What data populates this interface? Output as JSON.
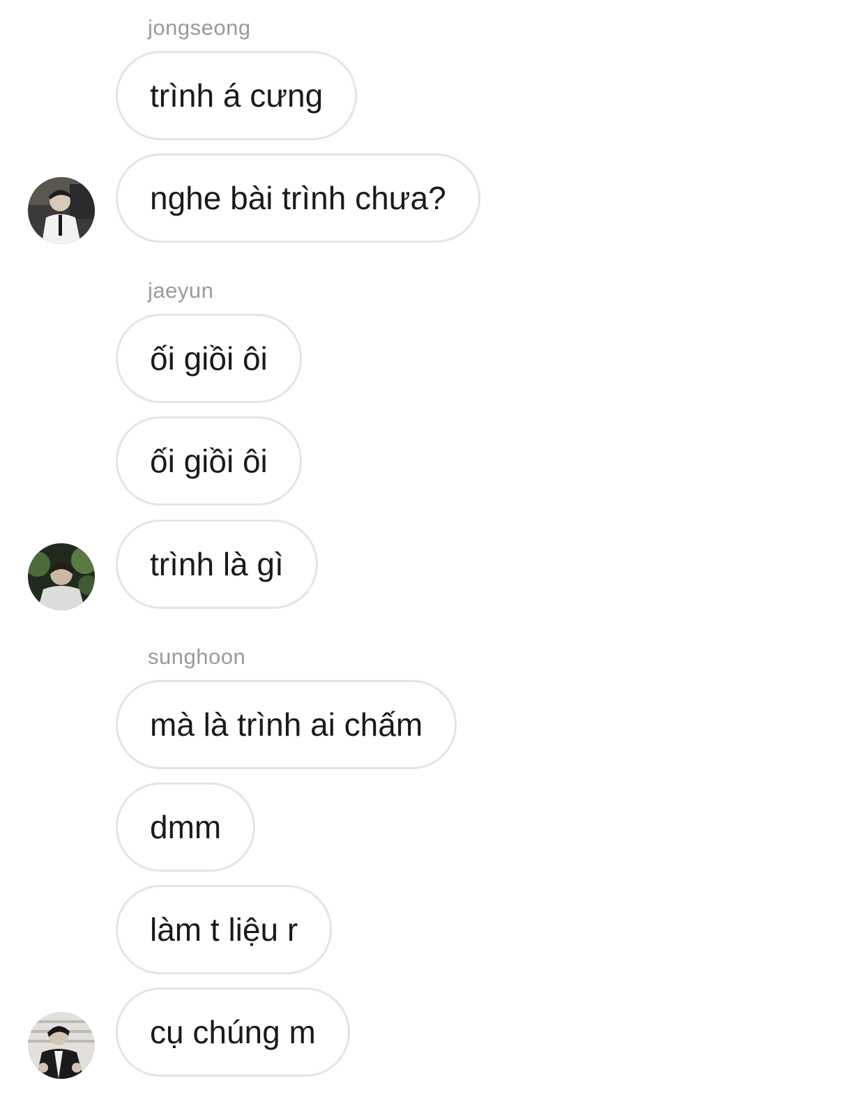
{
  "groups": [
    {
      "sender": "jongseong",
      "avatar": "profile-photo-jongseong",
      "messages": [
        "trình á cưng",
        "nghe bài trình chưa?"
      ]
    },
    {
      "sender": "jaeyun",
      "avatar": "profile-photo-jaeyun",
      "messages": [
        "ối giồi ôi",
        "ối giồi ôi",
        "trình là gì"
      ]
    },
    {
      "sender": "sunghoon",
      "avatar": "profile-photo-sunghoon",
      "messages": [
        "mà là trình ai chấm",
        "dmm",
        "làm t liệu r",
        "cụ chúng m"
      ]
    }
  ],
  "colors": {
    "background": "#ffffff",
    "bubble_border": "#e4e4e4",
    "message_text": "#1a1a1a",
    "sender_text": "#9a9a9a"
  }
}
